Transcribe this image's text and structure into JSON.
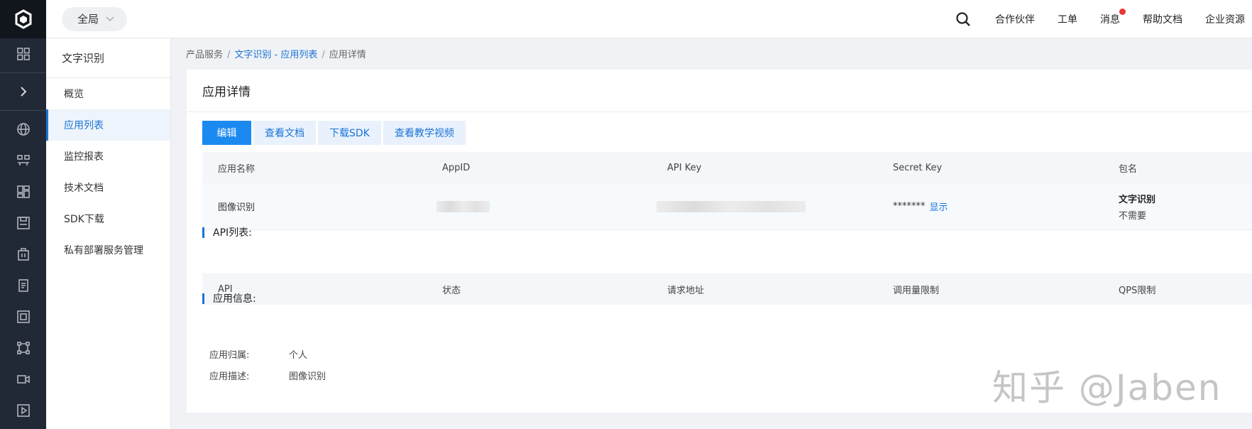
{
  "topbar": {
    "scope_label": "全局",
    "nav": [
      {
        "label": "合作伙伴"
      },
      {
        "label": "工单"
      },
      {
        "label": "消息"
      },
      {
        "label": "帮助文档"
      },
      {
        "label": "企业资源"
      }
    ]
  },
  "sidebar": {
    "title": "文字识别",
    "items": [
      {
        "label": "概览"
      },
      {
        "label": "应用列表"
      },
      {
        "label": "监控报表"
      },
      {
        "label": "技术文档"
      },
      {
        "label": "SDK下载"
      },
      {
        "label": "私有部署服务管理"
      }
    ]
  },
  "breadcrumb": {
    "root": "产品服务",
    "middle": "文字识别 - 应用列表",
    "current": "应用详情"
  },
  "detail": {
    "title": "应用详情",
    "buttons": {
      "edit": "编辑",
      "view_docs": "查看文档",
      "download_sdk": "下载SDK",
      "view_video": "查看教学视频"
    },
    "app_table": {
      "headers": [
        "应用名称",
        "AppID",
        "API Key",
        "Secret Key",
        "包名"
      ],
      "row": {
        "name": "图像识别",
        "secret_mask": "*******",
        "show_label": "显示",
        "package_bold": "文字识别",
        "package_note": "不需要"
      }
    },
    "api_section_title": "API列表:",
    "api_table": {
      "headers": [
        "API",
        "状态",
        "请求地址",
        "调用量限制",
        "QPS限制"
      ]
    },
    "info_section_title": "应用信息:",
    "info": {
      "owner_label": "应用归属:",
      "owner_value": "个人",
      "desc_label": "应用描述:",
      "desc_value": "图像识别"
    }
  },
  "watermark": "知乎 @Jaben",
  "colors": {
    "accent": "#1b73d6",
    "primary_button": "#1b8af0",
    "rail": "#222936"
  }
}
